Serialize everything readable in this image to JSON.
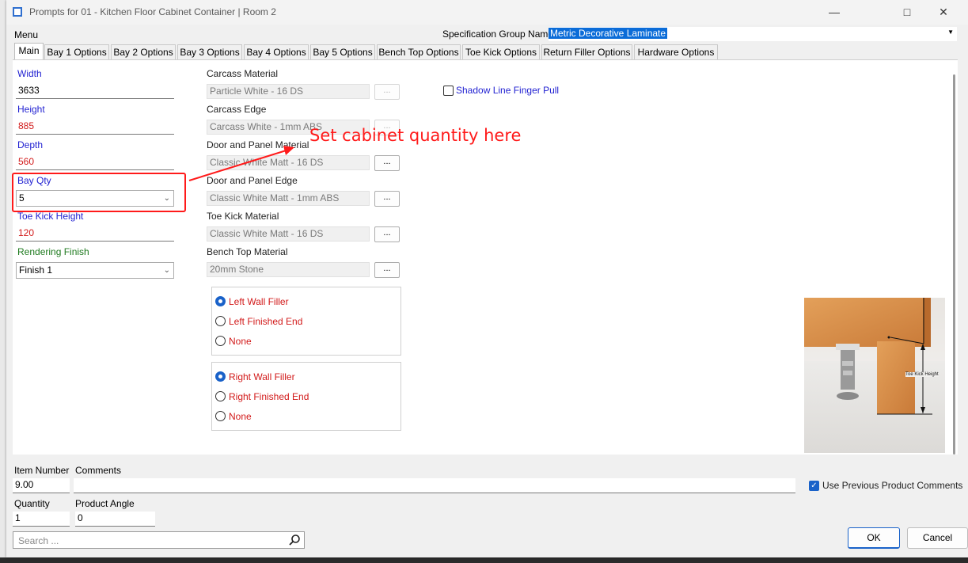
{
  "window": {
    "title": "Prompts for 01 - Kitchen Floor Cabinet Container | Room 2",
    "minimize_glyph": "—",
    "maximize_glyph": "□",
    "close_glyph": "✕"
  },
  "menu": {
    "label": "Menu"
  },
  "spec_group": {
    "label": "Specification Group Name",
    "value": "Metric Decorative Laminate"
  },
  "tabs": [
    {
      "label": "Main"
    },
    {
      "label": "Bay 1 Options"
    },
    {
      "label": "Bay 2 Options"
    },
    {
      "label": "Bay 3 Options"
    },
    {
      "label": "Bay 4 Options"
    },
    {
      "label": "Bay 5 Options"
    },
    {
      "label": "Bench Top Options"
    },
    {
      "label": "Toe Kick Options"
    },
    {
      "label": "Return Filler Options"
    },
    {
      "label": "Hardware Options"
    }
  ],
  "fields": {
    "width": {
      "label": "Width",
      "value": "3633"
    },
    "height": {
      "label": "Height",
      "value": "885"
    },
    "depth": {
      "label": "Depth",
      "value": "560"
    },
    "bay_qty": {
      "label": "Bay Qty",
      "value": "5"
    },
    "toe_kick_height": {
      "label": "Toe Kick Height",
      "value": "120"
    },
    "rendering_finish": {
      "label": "Rendering Finish",
      "value": "Finish 1"
    }
  },
  "materials": [
    {
      "label": "Carcass Material",
      "value": "Particle White - 16 DS",
      "button": "..."
    },
    {
      "label": "Carcass Edge",
      "value": "Carcass White - 1mm  ABS",
      "button": "..."
    },
    {
      "label": "Door and Panel Material",
      "value": "Classic White Matt - 16 DS",
      "button": "..."
    },
    {
      "label": "Door and Panel Edge",
      "value": "Classic White Matt - 1mm ABS",
      "button": "..."
    },
    {
      "label": "Toe Kick Material",
      "value": "Classic White Matt - 16 DS",
      "button": "..."
    },
    {
      "label": "Bench Top Material",
      "value": "20mm Stone",
      "button": "..."
    }
  ],
  "left_options": [
    "Left Wall Filler",
    "Left Finished End",
    "None"
  ],
  "right_options": [
    "Right Wall Filler",
    "Right Finished End",
    "None"
  ],
  "shadow_line": {
    "label": "Shadow Line Finger Pull"
  },
  "annotation": {
    "text": "Set cabinet quantity here",
    "color": "#ff1a1a"
  },
  "image": {
    "caption": "Toe Kick Height"
  },
  "footer": {
    "item_number": {
      "label": "Item Number",
      "value": "9.00"
    },
    "comments": {
      "label": "Comments",
      "value": ""
    },
    "quantity": {
      "label": "Quantity",
      "value": "1"
    },
    "product_angle": {
      "label": "Product Angle",
      "value": "0"
    },
    "use_previous": {
      "label": "Use Previous Product Comments"
    },
    "search": {
      "placeholder": "Search ..."
    },
    "ok": "OK",
    "cancel": "Cancel"
  },
  "colors": {
    "accent": "#1a62c9",
    "blue_label": "#1f1fd1",
    "red_label": "#d21a1a",
    "green_label": "#1e7a1e"
  }
}
